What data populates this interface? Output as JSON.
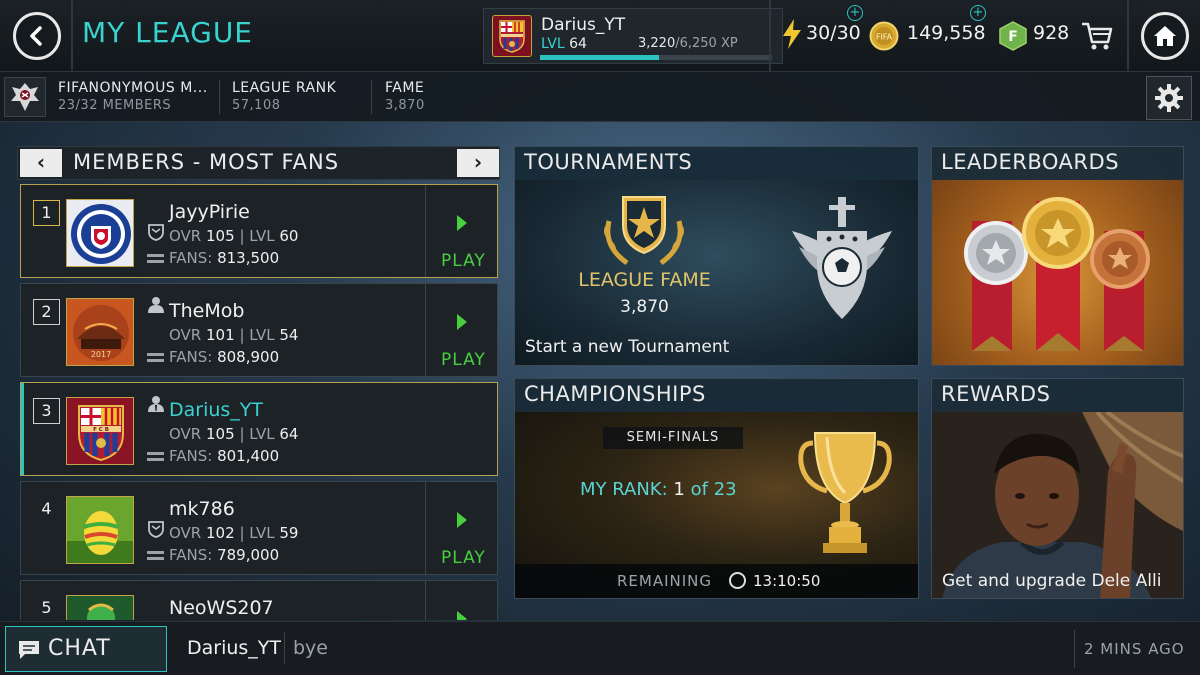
{
  "header": {
    "title": "MY LEAGUE",
    "profile": {
      "name": "Darius_YT",
      "level_label": "LVL",
      "level": "64",
      "xp_current": "3,220",
      "xp_max": "/6,250 XP",
      "xp_progress": 0.515
    },
    "energy": "30/30",
    "coins": "149,558",
    "fifa_points": "928"
  },
  "league": {
    "name": "FIFANONYMOUS M...",
    "members": "23/32 MEMBERS",
    "rank_label": "LEAGUE RANK",
    "rank_value": "57,108",
    "fame_label": "FAME",
    "fame_value": "3,870"
  },
  "members_panel": {
    "title": "MEMBERS - MOST FANS",
    "prev": "‹",
    "next": "›",
    "rows": [
      {
        "rank": "1",
        "name": "JayyPirie",
        "ovr_label": "OVR",
        "ovr": "105",
        "lvl_label": "LVL",
        "lvl": "60",
        "fans_label": "FANS:",
        "fans": "813,500",
        "action": "PLAY",
        "crest": "rangers-crest-icon"
      },
      {
        "rank": "2",
        "name": "TheMob",
        "ovr_label": "OVR",
        "ovr": "101",
        "lvl_label": "LVL",
        "lvl": "54",
        "fans_label": "FANS:",
        "fans": "808,900",
        "action": "PLAY",
        "crest": "stadium-crest-icon"
      },
      {
        "rank": "3",
        "name": "Darius_YT",
        "ovr_label": "OVR",
        "ovr": "105",
        "lvl_label": "LVL",
        "lvl": "64",
        "fans_label": "FANS:",
        "fans": "801,400",
        "action": "",
        "crest": "barcelona-crest-icon"
      },
      {
        "rank": "4",
        "name": "mk786",
        "ovr_label": "OVR",
        "ovr": "102",
        "lvl_label": "LVL",
        "lvl": "59",
        "fans_label": "FANS:",
        "fans": "789,000",
        "action": "PLAY",
        "crest": "egg-crest-icon"
      },
      {
        "rank": "5",
        "name": "NeoWS207",
        "action": "",
        "crest": "green-crest-icon"
      }
    ]
  },
  "tiles": {
    "tournaments": {
      "title": "TOURNAMENTS",
      "fame_label": "LEAGUE FAME",
      "fame_value": "3,870",
      "cta": "Start a new Tournament"
    },
    "leaderboards": {
      "title": "LEADERBOARDS"
    },
    "championships": {
      "title": "CHAMPIONSHIPS",
      "stage": "SEMI-FINALS",
      "rank_label": "MY RANK:",
      "rank": "1",
      "of": "of",
      "total": "23",
      "remaining_label": "REMAINING",
      "remaining_time": "13:10:50"
    },
    "rewards": {
      "title": "REWARDS",
      "caption": "Get and upgrade Dele Alli"
    }
  },
  "chat": {
    "label": "CHAT",
    "last_user": "Darius_YT",
    "last_message": "bye",
    "time": "2 MINS AGO"
  },
  "colors": {
    "accent": "#38d2cf",
    "play": "#47cf3e",
    "gold": "#e1c36a"
  }
}
